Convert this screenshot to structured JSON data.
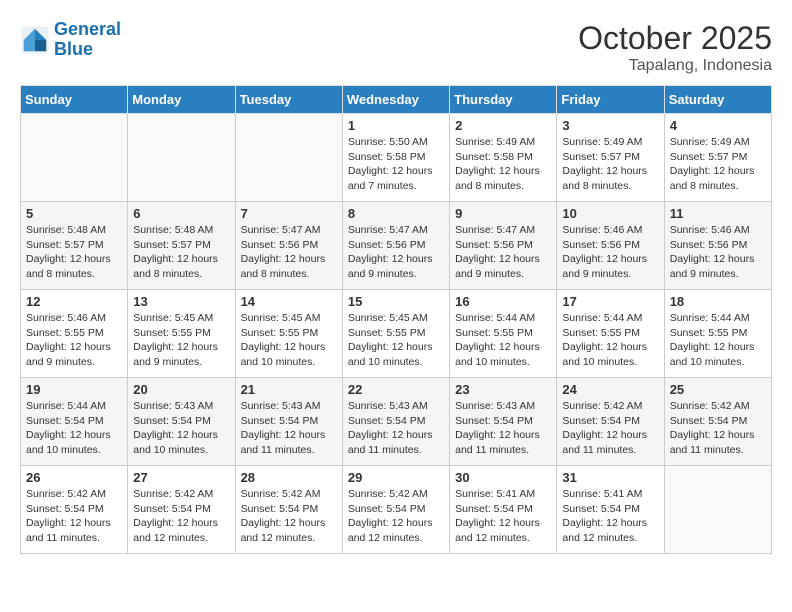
{
  "header": {
    "logo_line1": "General",
    "logo_line2": "Blue",
    "month": "October 2025",
    "location": "Tapalang, Indonesia"
  },
  "days_of_week": [
    "Sunday",
    "Monday",
    "Tuesday",
    "Wednesday",
    "Thursday",
    "Friday",
    "Saturday"
  ],
  "weeks": [
    [
      {
        "day": "",
        "info": ""
      },
      {
        "day": "",
        "info": ""
      },
      {
        "day": "",
        "info": ""
      },
      {
        "day": "1",
        "info": "Sunrise: 5:50 AM\nSunset: 5:58 PM\nDaylight: 12 hours\nand 7 minutes."
      },
      {
        "day": "2",
        "info": "Sunrise: 5:49 AM\nSunset: 5:58 PM\nDaylight: 12 hours\nand 8 minutes."
      },
      {
        "day": "3",
        "info": "Sunrise: 5:49 AM\nSunset: 5:57 PM\nDaylight: 12 hours\nand 8 minutes."
      },
      {
        "day": "4",
        "info": "Sunrise: 5:49 AM\nSunset: 5:57 PM\nDaylight: 12 hours\nand 8 minutes."
      }
    ],
    [
      {
        "day": "5",
        "info": "Sunrise: 5:48 AM\nSunset: 5:57 PM\nDaylight: 12 hours\nand 8 minutes."
      },
      {
        "day": "6",
        "info": "Sunrise: 5:48 AM\nSunset: 5:57 PM\nDaylight: 12 hours\nand 8 minutes."
      },
      {
        "day": "7",
        "info": "Sunrise: 5:47 AM\nSunset: 5:56 PM\nDaylight: 12 hours\nand 8 minutes."
      },
      {
        "day": "8",
        "info": "Sunrise: 5:47 AM\nSunset: 5:56 PM\nDaylight: 12 hours\nand 9 minutes."
      },
      {
        "day": "9",
        "info": "Sunrise: 5:47 AM\nSunset: 5:56 PM\nDaylight: 12 hours\nand 9 minutes."
      },
      {
        "day": "10",
        "info": "Sunrise: 5:46 AM\nSunset: 5:56 PM\nDaylight: 12 hours\nand 9 minutes."
      },
      {
        "day": "11",
        "info": "Sunrise: 5:46 AM\nSunset: 5:56 PM\nDaylight: 12 hours\nand 9 minutes."
      }
    ],
    [
      {
        "day": "12",
        "info": "Sunrise: 5:46 AM\nSunset: 5:55 PM\nDaylight: 12 hours\nand 9 minutes."
      },
      {
        "day": "13",
        "info": "Sunrise: 5:45 AM\nSunset: 5:55 PM\nDaylight: 12 hours\nand 9 minutes."
      },
      {
        "day": "14",
        "info": "Sunrise: 5:45 AM\nSunset: 5:55 PM\nDaylight: 12 hours\nand 10 minutes."
      },
      {
        "day": "15",
        "info": "Sunrise: 5:45 AM\nSunset: 5:55 PM\nDaylight: 12 hours\nand 10 minutes."
      },
      {
        "day": "16",
        "info": "Sunrise: 5:44 AM\nSunset: 5:55 PM\nDaylight: 12 hours\nand 10 minutes."
      },
      {
        "day": "17",
        "info": "Sunrise: 5:44 AM\nSunset: 5:55 PM\nDaylight: 12 hours\nand 10 minutes."
      },
      {
        "day": "18",
        "info": "Sunrise: 5:44 AM\nSunset: 5:55 PM\nDaylight: 12 hours\nand 10 minutes."
      }
    ],
    [
      {
        "day": "19",
        "info": "Sunrise: 5:44 AM\nSunset: 5:54 PM\nDaylight: 12 hours\nand 10 minutes."
      },
      {
        "day": "20",
        "info": "Sunrise: 5:43 AM\nSunset: 5:54 PM\nDaylight: 12 hours\nand 10 minutes."
      },
      {
        "day": "21",
        "info": "Sunrise: 5:43 AM\nSunset: 5:54 PM\nDaylight: 12 hours\nand 11 minutes."
      },
      {
        "day": "22",
        "info": "Sunrise: 5:43 AM\nSunset: 5:54 PM\nDaylight: 12 hours\nand 11 minutes."
      },
      {
        "day": "23",
        "info": "Sunrise: 5:43 AM\nSunset: 5:54 PM\nDaylight: 12 hours\nand 11 minutes."
      },
      {
        "day": "24",
        "info": "Sunrise: 5:42 AM\nSunset: 5:54 PM\nDaylight: 12 hours\nand 11 minutes."
      },
      {
        "day": "25",
        "info": "Sunrise: 5:42 AM\nSunset: 5:54 PM\nDaylight: 12 hours\nand 11 minutes."
      }
    ],
    [
      {
        "day": "26",
        "info": "Sunrise: 5:42 AM\nSunset: 5:54 PM\nDaylight: 12 hours\nand 11 minutes."
      },
      {
        "day": "27",
        "info": "Sunrise: 5:42 AM\nSunset: 5:54 PM\nDaylight: 12 hours\nand 12 minutes."
      },
      {
        "day": "28",
        "info": "Sunrise: 5:42 AM\nSunset: 5:54 PM\nDaylight: 12 hours\nand 12 minutes."
      },
      {
        "day": "29",
        "info": "Sunrise: 5:42 AM\nSunset: 5:54 PM\nDaylight: 12 hours\nand 12 minutes."
      },
      {
        "day": "30",
        "info": "Sunrise: 5:41 AM\nSunset: 5:54 PM\nDaylight: 12 hours\nand 12 minutes."
      },
      {
        "day": "31",
        "info": "Sunrise: 5:41 AM\nSunset: 5:54 PM\nDaylight: 12 hours\nand 12 minutes."
      },
      {
        "day": "",
        "info": ""
      }
    ]
  ]
}
